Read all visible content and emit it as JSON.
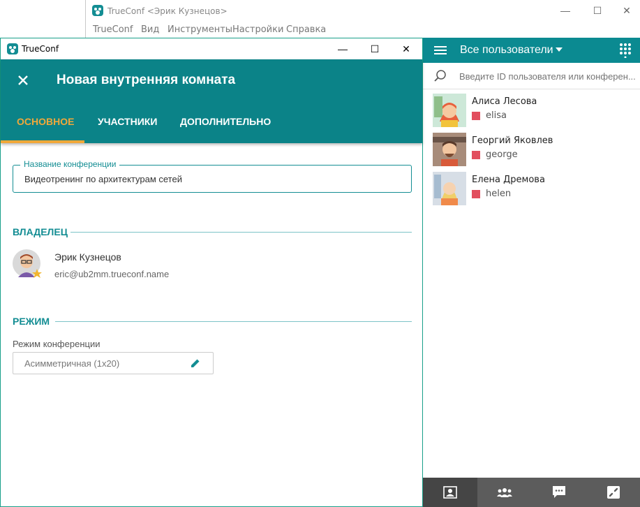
{
  "main_window": {
    "title": "TrueConf <Эрик Кузнецов>",
    "menu": [
      "TrueConf",
      "Вид",
      "Инструменты",
      "Настройки",
      "Справка"
    ]
  },
  "contacts": {
    "header_title": "Все пользователи",
    "search_placeholder": "Введите ID пользователя или конферен...",
    "items": [
      {
        "name": "Алиса Лесова",
        "login": "elisa",
        "status": "offline"
      },
      {
        "name": "Георгий Яковлев",
        "login": "george",
        "status": "offline"
      },
      {
        "name": "Елена Дремова",
        "login": "helen",
        "status": "offline"
      }
    ],
    "bottom_tabs": [
      "contacts-book-icon",
      "group-icon",
      "chat-icon",
      "call-icon"
    ]
  },
  "dialog": {
    "window_title": "TrueConf",
    "heading": "Новая внутренняя комната",
    "tabs": [
      "ОСНОВНОЕ",
      "УЧАСТНИКИ",
      "ДОПОЛНИТЕЛЬНО"
    ],
    "active_tab": 0,
    "conference_name": {
      "label": "Название конференции",
      "value": "Видеотренинг по архитектурам сетей"
    },
    "owner": {
      "section_title": "ВЛАДЕЛЕЦ",
      "name": "Эрик Кузнецов",
      "email": "eric@ub2mm.trueconf.name"
    },
    "mode": {
      "section_title": "РЕЖИМ",
      "label": "Режим конференции",
      "value": "Асимметричная (1x20)"
    }
  },
  "colors": {
    "accent": "#0b8388",
    "tab_active": "#f0a83a",
    "status_offline": "#e24e5e"
  }
}
